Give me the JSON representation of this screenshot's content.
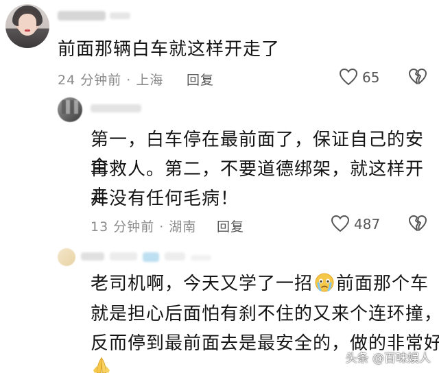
{
  "comments": [
    {
      "text": "前面那辆白车就这样开走了",
      "meta": "24 分钟前 · 上海",
      "reply_label": "回复",
      "likes": "65"
    },
    {
      "lines": [
        "第一，白车停在最前面了，保证自己的安全",
        "再救人。第二，不要道德绑架，就这样开走",
        "并没有任何毛病！"
      ],
      "meta": "13 分钟前 · 湖南",
      "reply_label": "回复",
      "likes": "487"
    },
    {
      "line1_a": "老司机啊，今天又学了一招",
      "line1_b": "前面那个车",
      "line2": "就是担心后面怕有刹不住的又来个连环撞，",
      "line3": "反而停到最前面去是最安全的，做的非常好"
    }
  ],
  "watermark": "头条 @百味娱人",
  "icons": {
    "like": "heart-outline-icon",
    "dislike": "broken-heart-icon",
    "emoji_cry": "crying-face-emoji",
    "emoji_pray": "folded-hands-emoji"
  },
  "colors": {
    "text": "#141414",
    "meta": "#8a8a8a",
    "icon": "#555555"
  }
}
